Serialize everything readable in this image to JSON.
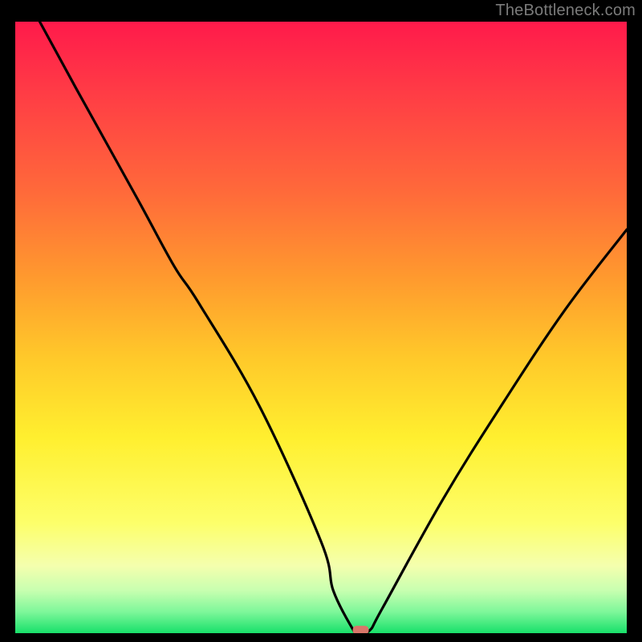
{
  "watermark": "TheBottleneck.com",
  "chart_data": {
    "type": "line",
    "title": "",
    "xlabel": "",
    "ylabel": "",
    "xlim": [
      0,
      100
    ],
    "ylim": [
      0,
      100
    ],
    "grid": false,
    "legend": false,
    "curve_description": "V-shaped curve descending from top-left, reaching minimum near x≈56, then rising toward the right edge; drawn over a vertical rainbow gradient (red at top through orange, yellow, light-green to vivid green at bottom) inside a black frame.",
    "series": [
      {
        "name": "curve",
        "x": [
          4,
          10,
          20,
          26,
          30,
          40,
          50,
          52,
          55,
          56,
          58,
          60,
          70,
          80,
          90,
          100
        ],
        "y": [
          100,
          89,
          71,
          60,
          54,
          37,
          15,
          7,
          1,
          0,
          0.5,
          4,
          22,
          38,
          53,
          66
        ]
      }
    ],
    "marker": {
      "x": 56.5,
      "y": 0.5,
      "color": "#d9766a"
    },
    "gradient_stops": [
      {
        "offset": 0.0,
        "color": "#ff1a4b"
      },
      {
        "offset": 0.12,
        "color": "#ff3d45"
      },
      {
        "offset": 0.28,
        "color": "#ff6a3a"
      },
      {
        "offset": 0.42,
        "color": "#ff9a2e"
      },
      {
        "offset": 0.55,
        "color": "#ffc92a"
      },
      {
        "offset": 0.68,
        "color": "#ffef2f"
      },
      {
        "offset": 0.82,
        "color": "#fdff6a"
      },
      {
        "offset": 0.89,
        "color": "#f4ffae"
      },
      {
        "offset": 0.93,
        "color": "#c8ffb0"
      },
      {
        "offset": 0.965,
        "color": "#7ef79a"
      },
      {
        "offset": 1.0,
        "color": "#18e06a"
      }
    ]
  }
}
